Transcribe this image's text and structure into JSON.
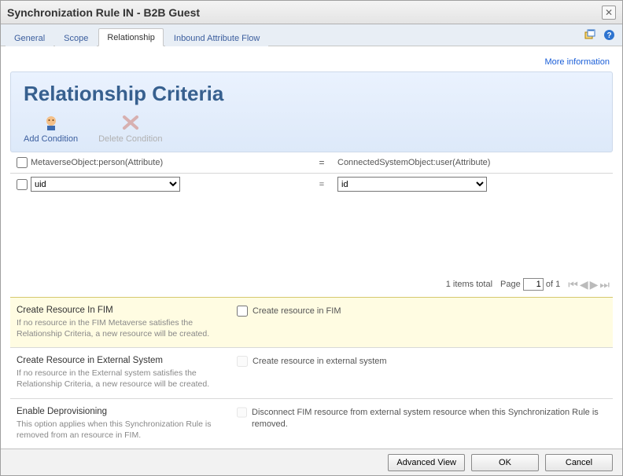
{
  "window": {
    "title": "Synchronization Rule IN - B2B Guest"
  },
  "tabs": {
    "general": "General",
    "scope": "Scope",
    "relationship": "Relationship",
    "flow": "Inbound Attribute Flow"
  },
  "moreinfo": "More information",
  "page": {
    "heading": "Relationship Criteria"
  },
  "toolbar": {
    "add": "Add Condition",
    "delete": "Delete Condition"
  },
  "gridHeaders": {
    "left": "MetaverseObject:person(Attribute)",
    "eq": "=",
    "right": "ConnectedSystemObject:user(Attribute)"
  },
  "row": {
    "left": "uid",
    "eq": "=",
    "right": "id"
  },
  "pager": {
    "total": "1 items total",
    "pageLabel": "Page",
    "pageValue": "1",
    "ofLabel": "of 1"
  },
  "opts": {
    "fim": {
      "title": "Create Resource In FIM",
      "sub": "If no resource in the FIM Metaverse satisfies the Relationship Criteria, a new resource will be created.",
      "ck": "Create resource in FIM"
    },
    "ext": {
      "title": "Create Resource in External System",
      "sub": "If no resource in the External system satisfies the Relationship Criteria, a new resource will be created.",
      "ck": "Create resource in external system"
    },
    "depro": {
      "title": "Enable Deprovisioning",
      "sub": "This option applies when this Synchronization Rule is removed from an resource in FIM.",
      "ck": "Disconnect FIM resource from external system resource when this Synchronization Rule is removed."
    }
  },
  "footer": {
    "adv": "Advanced View",
    "ok": "OK",
    "cancel": "Cancel"
  }
}
